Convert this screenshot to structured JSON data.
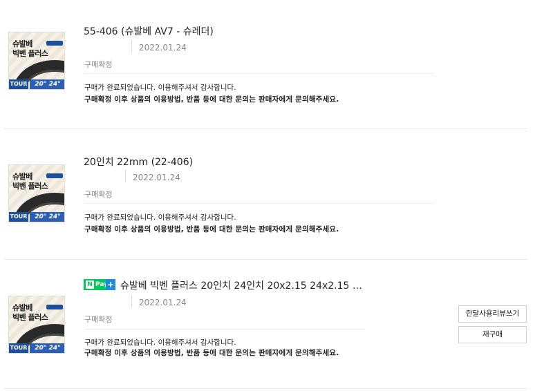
{
  "orders": [
    {
      "title": "55-406 (슈발베 AV7 - 슈레더)",
      "date": "2022.01.24",
      "status": "구매확정",
      "message_line1": "구매가 완료되었습니다. 이용해주셔서 감사합니다.",
      "message_line2": "구매확정 이후 상품의 이용방법, 반품 등에 대한 문의는 판매자에게 문의해주세요."
    },
    {
      "title": "20인치 22mm (22-406)",
      "date": "2022.01.24",
      "status": "구매확정",
      "message_line1": "구매가 완료되었습니다. 이용해주셔서 감사합니다.",
      "message_line2": "구매확정 이후 상품의 이용방법, 반품 등에 대한 문의는 판매자에게 문의해주세요."
    },
    {
      "npay_badge": "N Pay +",
      "title": "슈발베 빅벤 플러스 20인치 24인치 20x2.15 24x2.15 …",
      "date": "2022.01.24",
      "status": "구매확정",
      "message_line1": "구매가 완료되었습니다. 이용해주셔서 감사합니다.",
      "message_line2": "구매확정 이후 상품의 이용방법, 반품 등에 대한 문의는 판매자에게 문의해주세요.",
      "buttons": {
        "review": "한달사용리뷰쓰기",
        "rebuy": "재구매"
      }
    }
  ],
  "thumbnail": {
    "line1": "슈발베",
    "line2": "빅벤 플러스",
    "badge_tour": "TOUR",
    "badge_size": "20\" 24\""
  },
  "colors": {
    "npay_green": "#03c75a",
    "brand_blue": "#1c4fa0"
  }
}
